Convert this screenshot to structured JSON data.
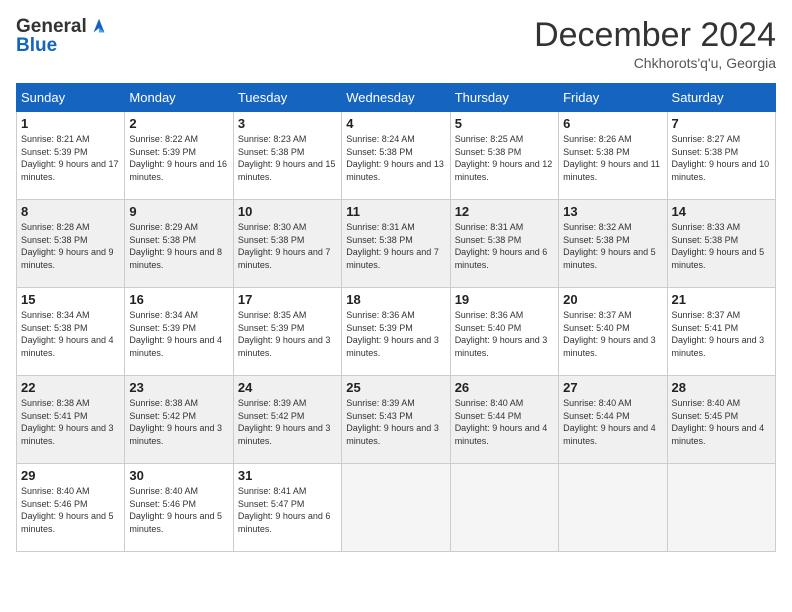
{
  "header": {
    "logo_general": "General",
    "logo_blue": "Blue",
    "month": "December 2024",
    "location": "Chkhorots'q'u, Georgia"
  },
  "weekdays": [
    "Sunday",
    "Monday",
    "Tuesday",
    "Wednesday",
    "Thursday",
    "Friday",
    "Saturday"
  ],
  "weeks": [
    [
      {
        "day": "1",
        "sunrise": "8:21 AM",
        "sunset": "5:39 PM",
        "daylight": "9 hours and 17 minutes."
      },
      {
        "day": "2",
        "sunrise": "8:22 AM",
        "sunset": "5:39 PM",
        "daylight": "9 hours and 16 minutes."
      },
      {
        "day": "3",
        "sunrise": "8:23 AM",
        "sunset": "5:38 PM",
        "daylight": "9 hours and 15 minutes."
      },
      {
        "day": "4",
        "sunrise": "8:24 AM",
        "sunset": "5:38 PM",
        "daylight": "9 hours and 13 minutes."
      },
      {
        "day": "5",
        "sunrise": "8:25 AM",
        "sunset": "5:38 PM",
        "daylight": "9 hours and 12 minutes."
      },
      {
        "day": "6",
        "sunrise": "8:26 AM",
        "sunset": "5:38 PM",
        "daylight": "9 hours and 11 minutes."
      },
      {
        "day": "7",
        "sunrise": "8:27 AM",
        "sunset": "5:38 PM",
        "daylight": "9 hours and 10 minutes."
      }
    ],
    [
      {
        "day": "8",
        "sunrise": "8:28 AM",
        "sunset": "5:38 PM",
        "daylight": "9 hours and 9 minutes."
      },
      {
        "day": "9",
        "sunrise": "8:29 AM",
        "sunset": "5:38 PM",
        "daylight": "9 hours and 8 minutes."
      },
      {
        "day": "10",
        "sunrise": "8:30 AM",
        "sunset": "5:38 PM",
        "daylight": "9 hours and 7 minutes."
      },
      {
        "day": "11",
        "sunrise": "8:31 AM",
        "sunset": "5:38 PM",
        "daylight": "9 hours and 7 minutes."
      },
      {
        "day": "12",
        "sunrise": "8:31 AM",
        "sunset": "5:38 PM",
        "daylight": "9 hours and 6 minutes."
      },
      {
        "day": "13",
        "sunrise": "8:32 AM",
        "sunset": "5:38 PM",
        "daylight": "9 hours and 5 minutes."
      },
      {
        "day": "14",
        "sunrise": "8:33 AM",
        "sunset": "5:38 PM",
        "daylight": "9 hours and 5 minutes."
      }
    ],
    [
      {
        "day": "15",
        "sunrise": "8:34 AM",
        "sunset": "5:38 PM",
        "daylight": "9 hours and 4 minutes."
      },
      {
        "day": "16",
        "sunrise": "8:34 AM",
        "sunset": "5:39 PM",
        "daylight": "9 hours and 4 minutes."
      },
      {
        "day": "17",
        "sunrise": "8:35 AM",
        "sunset": "5:39 PM",
        "daylight": "9 hours and 3 minutes."
      },
      {
        "day": "18",
        "sunrise": "8:36 AM",
        "sunset": "5:39 PM",
        "daylight": "9 hours and 3 minutes."
      },
      {
        "day": "19",
        "sunrise": "8:36 AM",
        "sunset": "5:40 PM",
        "daylight": "9 hours and 3 minutes."
      },
      {
        "day": "20",
        "sunrise": "8:37 AM",
        "sunset": "5:40 PM",
        "daylight": "9 hours and 3 minutes."
      },
      {
        "day": "21",
        "sunrise": "8:37 AM",
        "sunset": "5:41 PM",
        "daylight": "9 hours and 3 minutes."
      }
    ],
    [
      {
        "day": "22",
        "sunrise": "8:38 AM",
        "sunset": "5:41 PM",
        "daylight": "9 hours and 3 minutes."
      },
      {
        "day": "23",
        "sunrise": "8:38 AM",
        "sunset": "5:42 PM",
        "daylight": "9 hours and 3 minutes."
      },
      {
        "day": "24",
        "sunrise": "8:39 AM",
        "sunset": "5:42 PM",
        "daylight": "9 hours and 3 minutes."
      },
      {
        "day": "25",
        "sunrise": "8:39 AM",
        "sunset": "5:43 PM",
        "daylight": "9 hours and 3 minutes."
      },
      {
        "day": "26",
        "sunrise": "8:40 AM",
        "sunset": "5:44 PM",
        "daylight": "9 hours and 4 minutes."
      },
      {
        "day": "27",
        "sunrise": "8:40 AM",
        "sunset": "5:44 PM",
        "daylight": "9 hours and 4 minutes."
      },
      {
        "day": "28",
        "sunrise": "8:40 AM",
        "sunset": "5:45 PM",
        "daylight": "9 hours and 4 minutes."
      }
    ],
    [
      {
        "day": "29",
        "sunrise": "8:40 AM",
        "sunset": "5:46 PM",
        "daylight": "9 hours and 5 minutes."
      },
      {
        "day": "30",
        "sunrise": "8:40 AM",
        "sunset": "5:46 PM",
        "daylight": "9 hours and 5 minutes."
      },
      {
        "day": "31",
        "sunrise": "8:41 AM",
        "sunset": "5:47 PM",
        "daylight": "9 hours and 6 minutes."
      },
      null,
      null,
      null,
      null
    ]
  ]
}
